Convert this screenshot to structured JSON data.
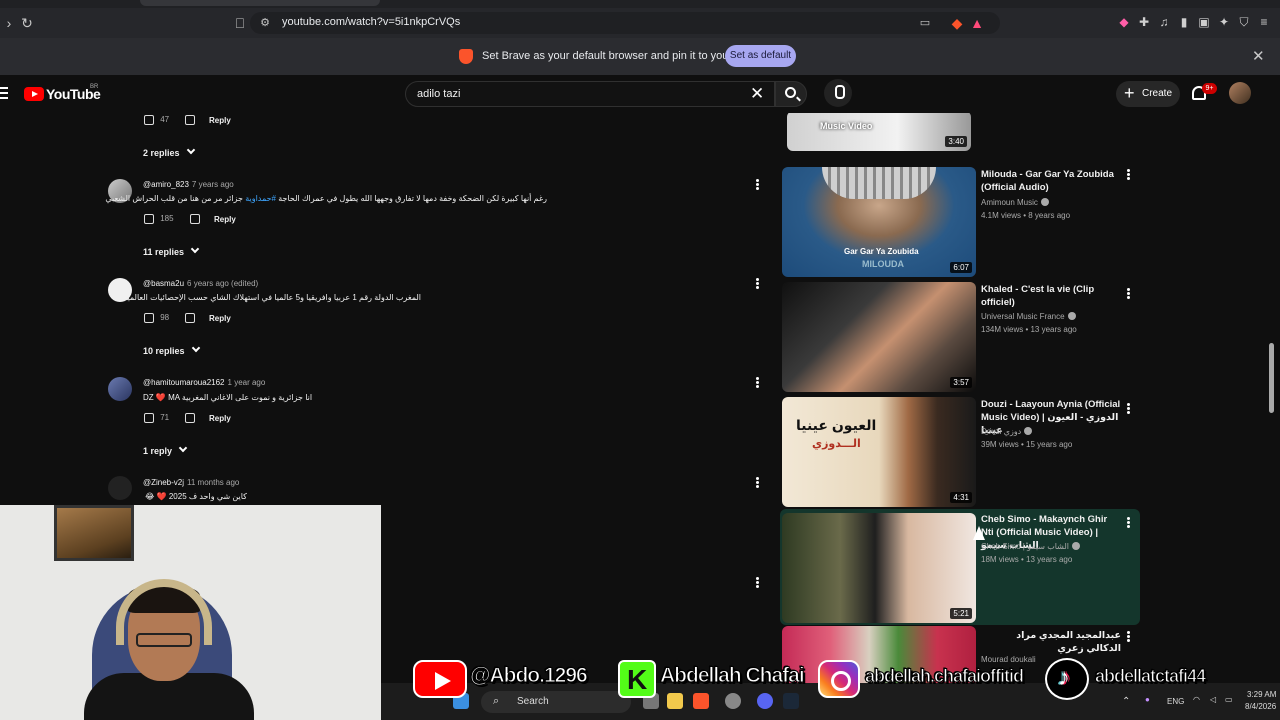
{
  "browser": {
    "url": "youtube.com/watch?v=5i1nkpCrVQs",
    "infobar_message": "Set Brave as your default browser and pin it to your taskbar",
    "infobar_button": "Set as default"
  },
  "youtube": {
    "logo_text": "YouTube",
    "country_code": "BR",
    "search_value": "adilo tazi",
    "create_label": "Create",
    "notif_badge": "9+"
  },
  "comments": {
    "top_like_count": "47",
    "reply_label": "Reply",
    "items": [
      {
        "replies": "2 replies"
      },
      {
        "user": "@amiro_823",
        "ago": "7 years ago",
        "text_a": "رغم أنها كبيرة لكن الضحكة وخفة دمها لا تفارق وجهها الله يطول في عمراك الحاجة ",
        "hashtag": "#حمداوية",
        "text_b": " جزائر مر من هنا من قلب الحراش الشعبي",
        "likes": "185",
        "replies": "11 replies"
      },
      {
        "user": "@basma2u",
        "ago": "6 years ago (edited)",
        "text": "المغرب الدولة رقم 1 عربيا وافريقيا و5 عالميا في استهلاك الشاي حسب الإحصائيات العالمية",
        "likes": "98",
        "replies": "10 replies"
      },
      {
        "user": "@hamitoumaroua2162",
        "ago": "1 year ago",
        "text_top": "انا جزائرية و نموت على الاغاني المغربية",
        "text": "DZ ❤️ MA",
        "likes": "71",
        "replies": "1 reply"
      },
      {
        "user": "@Zineb-v2j",
        "ago": "11 months ago",
        "text": "كاين شي واحد ف 2025 ❤️ 😂"
      }
    ]
  },
  "recommended": [
    {
      "thumb_label": "Music Video",
      "duration": "3:40"
    },
    {
      "title": "Milouda - Gar Gar Ya Zoubida (Official Audio)",
      "channel": "Amimoun Music",
      "meta": "4.1M views • 8 years ago",
      "thumb_label": "Gar Gar Ya Zoubida",
      "thumb_label2": "MILOUDA",
      "duration": "6:07"
    },
    {
      "title": "Khaled - C'est la vie (Clip officiel)",
      "channel": "Universal Music France",
      "meta": "134M views • 13 years ago",
      "duration": "3:57"
    },
    {
      "title": "Douzi - Laayoun Aynia (Official Music Video) | الدوزي - العيون عينيا",
      "channel": "Douzi دوزي",
      "meta": "39M views • 15 years ago",
      "thumb_label": "العيون عينيا",
      "thumb_label2": "الـــدوزي",
      "duration": "4:31"
    },
    {
      "title": "Cheb Simo - Makaynch Ghir Nti (Official Music Video) | الشاب سيمو",
      "channel": "Cheb Simo | الشاب سيمو",
      "meta": "18M views • 13 years ago",
      "duration": "5:21"
    },
    {
      "title": "عبدالمجيد المجدي مراد الدكالي زعري",
      "channel": "Mourad doukali"
    }
  ],
  "overlay": {
    "youtube_handle": "@Abdo.1296",
    "kick_name": "Abdellah Chafai",
    "instagram_handle": "abdellah.chafaioffitid",
    "tiktok_handle": "abdellatctafi44"
  },
  "taskbar": {
    "search_label": "Search",
    "lang": "ENG",
    "time": "3:29 AM",
    "date": "8/4/2026"
  }
}
